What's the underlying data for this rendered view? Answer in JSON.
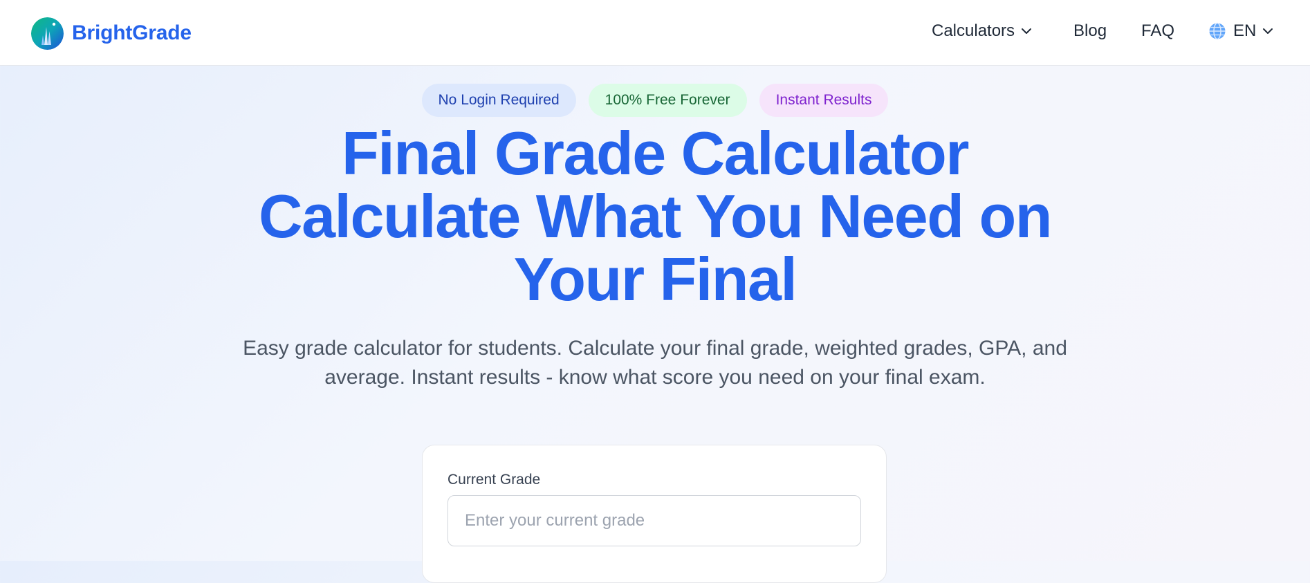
{
  "header": {
    "brand_name": "BrightGrade",
    "logo_icon": "brightgrade-logo-icon",
    "nav": {
      "calculators_label": "Calculators",
      "blog_label": "Blog",
      "faq_label": "FAQ",
      "language_label": "EN"
    }
  },
  "hero": {
    "badges": [
      {
        "label": "No Login Required",
        "color": "#1e40af",
        "bg": "#dde8fd"
      },
      {
        "label": "100% Free Forever",
        "color": "#166534",
        "bg": "#dcfce7"
      },
      {
        "label": "Instant Results",
        "color": "#7e22ce",
        "bg": "#f6e4fb"
      }
    ],
    "title_line1": "Final Grade Calculator",
    "title_line2": "Calculate What You Need on",
    "title_line3": "Your Final",
    "subtitle": "Easy grade calculator for students. Calculate your final grade, weighted grades, GPA, and average. Instant results - know what score you need on your final exam."
  },
  "calculator": {
    "current_grade_label": "Current Grade",
    "current_grade_value": "",
    "current_grade_placeholder": "Enter your current grade"
  },
  "colors": {
    "accent": "#2563eb",
    "text": "#1f2937",
    "muted": "#4b5563"
  }
}
